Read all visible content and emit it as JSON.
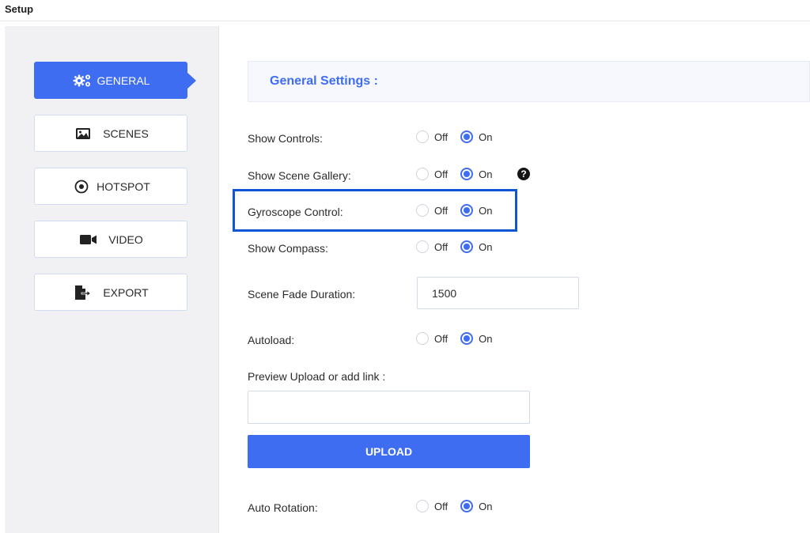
{
  "window": {
    "title": "Setup"
  },
  "sidebar": {
    "items": [
      {
        "label": "GENERAL",
        "icon": "gears-icon",
        "active": true
      },
      {
        "label": "SCENES",
        "icon": "image-icon",
        "active": false
      },
      {
        "label": "HOTSPOT",
        "icon": "target-icon",
        "active": false
      },
      {
        "label": "VIDEO",
        "icon": "video-camera-icon",
        "active": false
      },
      {
        "label": "EXPORT",
        "icon": "file-export-icon",
        "active": false
      }
    ]
  },
  "main": {
    "section_title": "General Settings :",
    "settings": {
      "show_controls": {
        "label": "Show Controls:",
        "off": "Off",
        "on": "On",
        "value": "On"
      },
      "show_scene_gallery": {
        "label": "Show Scene Gallery:",
        "off": "Off",
        "on": "On",
        "value": "On",
        "help_icon": "question-circle-icon"
      },
      "gyroscope_control": {
        "label": "Gyroscope Control:",
        "off": "Off",
        "on": "On",
        "value": "On",
        "highlighted": true
      },
      "show_compass": {
        "label": "Show Compass:",
        "off": "Off",
        "on": "On",
        "value": "On"
      },
      "scene_fade_duration": {
        "label": "Scene Fade Duration:",
        "value": "1500"
      },
      "autoload": {
        "label": "Autoload:",
        "off": "Off",
        "on": "On",
        "value": "On"
      },
      "preview": {
        "label": "Preview Upload or add link :",
        "value": "",
        "upload_label": "UPLOAD"
      },
      "auto_rotation": {
        "label": "Auto Rotation:",
        "off": "Off",
        "on": "On",
        "value": "On"
      }
    }
  },
  "colors": {
    "accent": "#3f6df2",
    "highlight_box": "#1055d6",
    "sidebar_bg": "#f1f1f3"
  }
}
